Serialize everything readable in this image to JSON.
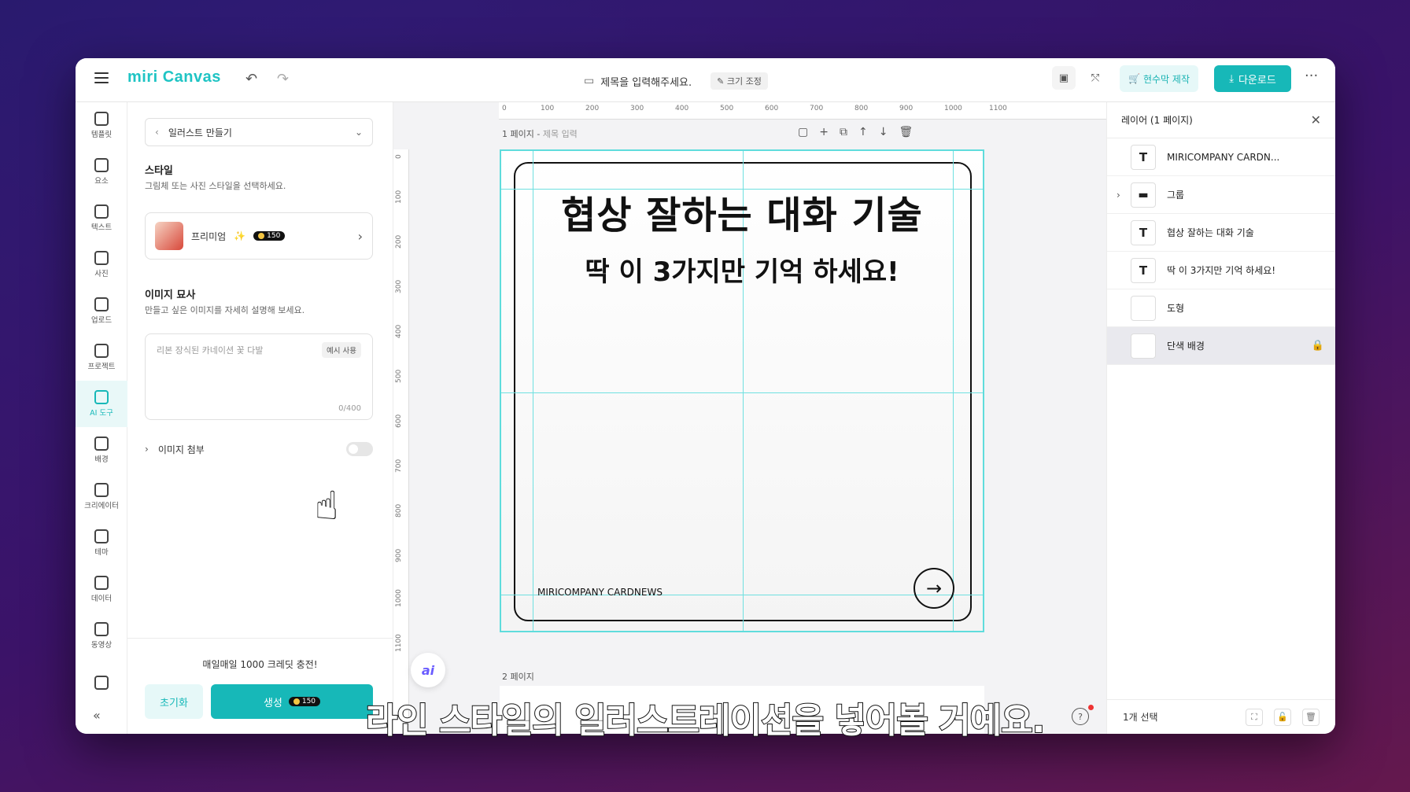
{
  "app": {
    "logo": "miri Canvas",
    "menu_icon": "hamburger-icon",
    "undo_icon": "undo-icon",
    "redo_icon": "redo-icon"
  },
  "header": {
    "doc_title": "제목을 입력해주세요.",
    "resize_label": "크기 조정",
    "banner_label": "현수막 제작",
    "download_label": "다운로드",
    "more": "···"
  },
  "iconbar": {
    "items": [
      {
        "label": "템플릿",
        "icon": "template-icon"
      },
      {
        "label": "요소",
        "icon": "elements-icon"
      },
      {
        "label": "텍스트",
        "icon": "text-icon"
      },
      {
        "label": "사진",
        "icon": "photo-icon"
      },
      {
        "label": "업로드",
        "icon": "upload-icon"
      },
      {
        "label": "프로젝트",
        "icon": "project-icon"
      },
      {
        "label": "AI 도구",
        "icon": "ai-tool-icon",
        "active": true
      },
      {
        "label": "배경",
        "icon": "background-icon"
      },
      {
        "label": "크리에이터",
        "icon": "creator-icon"
      },
      {
        "label": "테마",
        "icon": "theme-icon"
      },
      {
        "label": "데이터",
        "icon": "data-icon"
      },
      {
        "label": "동영상",
        "icon": "video-icon"
      },
      {
        "label": "",
        "icon": "music-icon"
      }
    ],
    "collapse": "«"
  },
  "panel": {
    "dropdown_label": "일러스트 만들기",
    "style_title": "스타일",
    "style_desc": "그림체 또는 사진 스타일을 선택하세요.",
    "style_card_label": "프리미엄",
    "style_card_sparkle": "✨",
    "style_card_credits": "150",
    "image_desc_title": "이미지 묘사",
    "image_desc_desc": "만들고 싶은 이미지를 자세히 설명해 보세요.",
    "desc_placeholder": "리본 장식된 카네이션 꽃 다발",
    "example_button": "예시 사용",
    "char_count": "0/400",
    "attach_label": "이미지 첨부",
    "charge_text": "매일매일 1000 크레딧 충전!",
    "reset_button": "초기화",
    "generate_button": "생성",
    "generate_credits": "150"
  },
  "canvas": {
    "ruler_top": [
      "0",
      "100",
      "200",
      "300",
      "400",
      "500",
      "600",
      "700",
      "800",
      "900",
      "1000",
      "1100"
    ],
    "ruler_left": [
      "0",
      "100",
      "200",
      "300",
      "400",
      "500",
      "600",
      "700",
      "800",
      "900",
      "1000",
      "1100"
    ],
    "page1_label": "1 페이지 -",
    "page1_sub": "제목 입력",
    "headline": "협상 잘하는 대화 기술",
    "subline": "딱 이 3가지만 기억 하세요!",
    "footer_text": "MIRICOMPANY CARDNEWS",
    "page2_label": "2 페이지",
    "ai_fab": "ai"
  },
  "layers": {
    "title": "레이어 (1 페이지)",
    "items": [
      {
        "label": "MIRICOMPANY CARDN...",
        "type": "T"
      },
      {
        "label": "그룹",
        "type": "folder",
        "expandable": true
      },
      {
        "label": "협상 잘하는 대화 기술",
        "type": "T"
      },
      {
        "label": "딱 이 3가지만 기억 하세요!",
        "type": "T"
      },
      {
        "label": "도형",
        "type": "shape"
      },
      {
        "label": "단색 배경",
        "type": "bg",
        "selected": true,
        "locked": true
      }
    ],
    "selection_count": "1개 선택"
  },
  "subtitle": "라인 스타일의 일러스트레이션을 넣어볼 거예요."
}
